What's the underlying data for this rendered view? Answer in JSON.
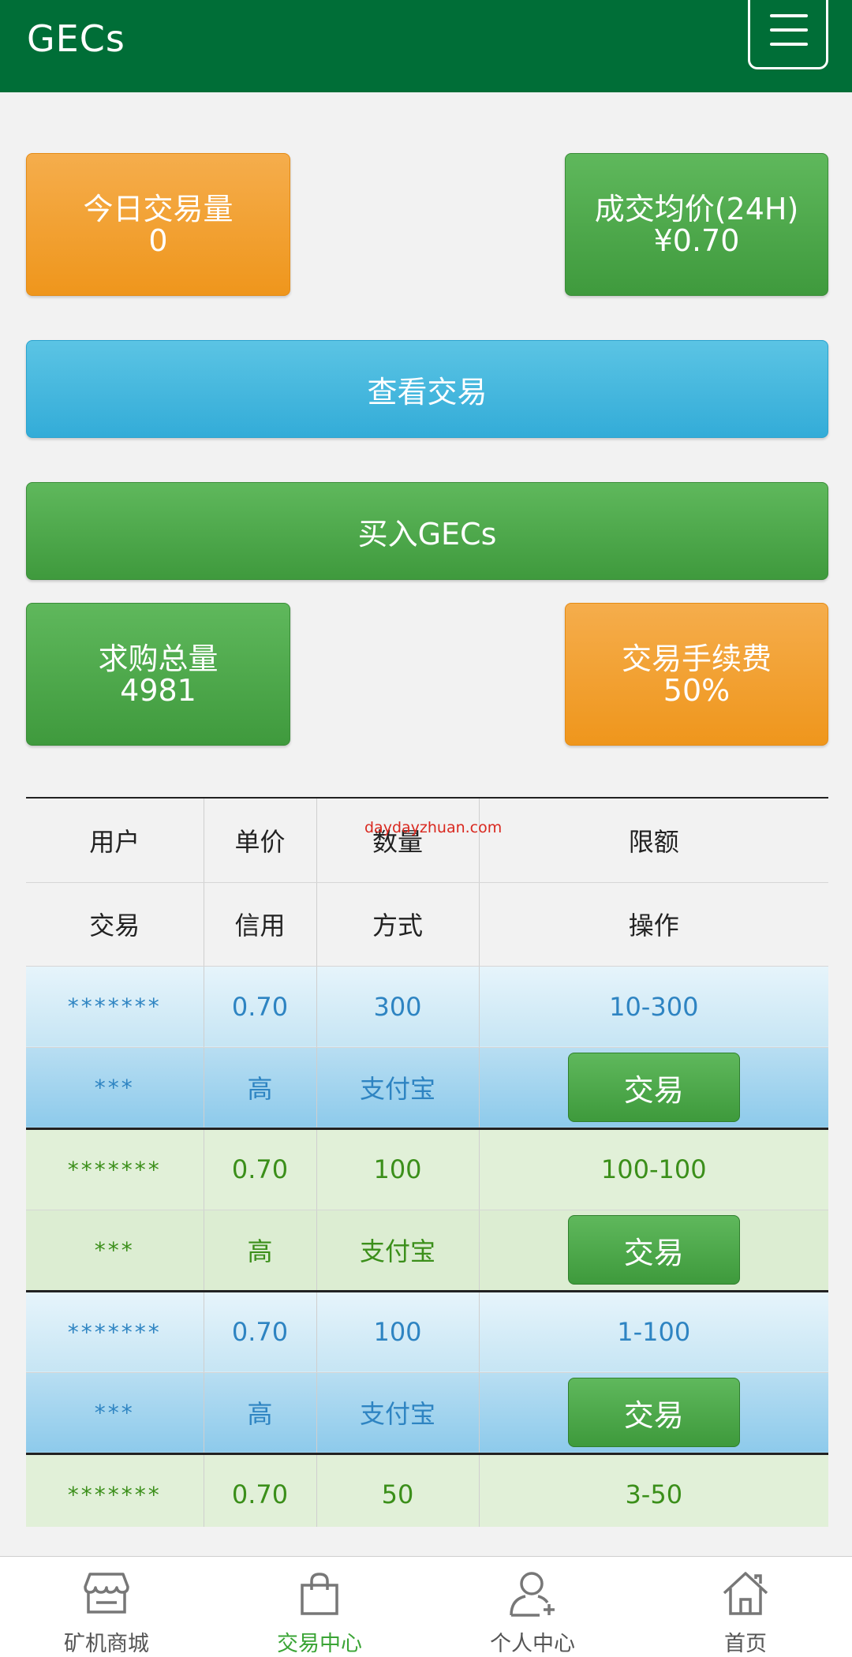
{
  "header": {
    "title": "GECs"
  },
  "stats": {
    "today_volume_label": "今日交易量",
    "today_volume_value": "0",
    "avg_price_label": "成交均价(24H)",
    "avg_price_value": "¥0.70",
    "total_demand_label": "求购总量",
    "total_demand_value": "4981",
    "fee_label": "交易手续费",
    "fee_value": "50%"
  },
  "actions": {
    "view_trades": "查看交易",
    "buy": "买入GECs"
  },
  "watermark": "daydayzhuan.com",
  "table": {
    "headers_row1": [
      "用户",
      "单价",
      "数量",
      "限额"
    ],
    "headers_row2": [
      "交易",
      "信用",
      "方式",
      "操作"
    ],
    "rows": [
      {
        "user": "*******",
        "price": "0.70",
        "qty": "300",
        "limit": "10-300",
        "trade": "***",
        "credit": "高",
        "method": "支付宝",
        "action": "交易"
      },
      {
        "user": "*******",
        "price": "0.70",
        "qty": "100",
        "limit": "100-100",
        "trade": "***",
        "credit": "高",
        "method": "支付宝",
        "action": "交易"
      },
      {
        "user": "*******",
        "price": "0.70",
        "qty": "100",
        "limit": "1-100",
        "trade": "***",
        "credit": "高",
        "method": "支付宝",
        "action": "交易"
      },
      {
        "user": "*******",
        "price": "0.70",
        "qty": "50",
        "limit": "3-50"
      }
    ]
  },
  "tabbar": {
    "items": [
      {
        "label": "矿机商城",
        "icon": "store-icon"
      },
      {
        "label": "交易中心",
        "icon": "bag-icon"
      },
      {
        "label": "个人中心",
        "icon": "user-add-icon"
      },
      {
        "label": "首页",
        "icon": "home-icon"
      }
    ],
    "active_color": "#3aa435"
  }
}
